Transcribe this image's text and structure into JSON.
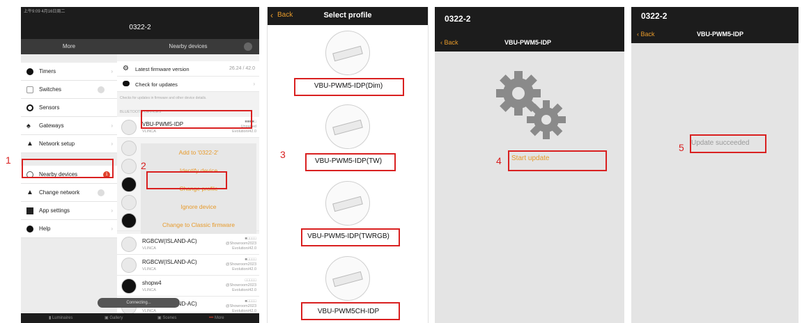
{
  "steps": [
    "1",
    "2",
    "3",
    "4",
    "5"
  ],
  "panel1": {
    "status_left": "上午9:09  4月16日周二",
    "title": "0322-2",
    "left_header": "More",
    "right_header": "Nearby devices",
    "menu": [
      {
        "label": "Timers",
        "icon": "clock-icon"
      },
      {
        "label": "Switches",
        "icon": "switch-icon"
      },
      {
        "label": "Sensors",
        "icon": "sensor-icon"
      },
      {
        "label": "Gateways",
        "icon": "gateway-icon"
      },
      {
        "label": "Network setup",
        "icon": "network-icon"
      },
      {
        "label": "Nearby devices",
        "icon": "nearby-icon",
        "badge": "1"
      },
      {
        "label": "Change network",
        "icon": "change-network-icon"
      },
      {
        "label": "App settings",
        "icon": "settings-icon"
      },
      {
        "label": "Help",
        "icon": "help-icon"
      }
    ],
    "firmware_label": "Latest firmware version",
    "firmware_value": "26.24 / 42.0",
    "check_updates": "Check for updates",
    "check_updates_hint": "Checks for updates in firmware and other device details.",
    "bluetooth_header": "BLUETOOTH DEVICES",
    "selected_device": {
      "name": "VBU-PWM5-IDP",
      "vendor": "VLINCA",
      "status": "Unpaired",
      "meta": "Evolution/42.0"
    },
    "context_menu": [
      "Add to '0322-2'",
      "Identify device",
      "Change profile",
      "Ignore device",
      "Change to Classic firmware"
    ],
    "devices": [
      {
        "name": "RGBCW(ISLAND-AC)",
        "vendor": "VLINCA",
        "meta1": "@Showroom2023",
        "meta2": "Evolution/42.0"
      },
      {
        "name": "RGBCW(ISLAND-AC)",
        "vendor": "VLINCA",
        "meta1": "@Showroom2023",
        "meta2": "Evolution/42.0"
      },
      {
        "name": "shopw4",
        "vendor": "VLINCA",
        "meta1": "@Showroom2023",
        "meta2": "Evolution/42.0"
      },
      {
        "name": "RGBCW(ISLAND-AC)",
        "vendor": "VLINCA",
        "meta1": "@Showroom2023",
        "meta2": "Evolution/42.0"
      }
    ],
    "toast": "Connecting...",
    "tabs": [
      "Luminaires",
      "Gallery",
      "Scenes",
      "More"
    ]
  },
  "panel2": {
    "back": "Back",
    "title": "Select profile",
    "profiles": [
      "VBU-PWM5-IDP(Dim)",
      "VBU-PWM5-IDP(TW)",
      "VBU-PWM5-IDP(TWRGB)",
      "VBU-PWM5CH-IDP"
    ]
  },
  "panel3": {
    "network": "0322-2",
    "back": "Back",
    "title": "VBU-PWM5-IDP",
    "action": "Start update"
  },
  "panel4": {
    "network": "0322-2",
    "back": "Back",
    "title": "VBU-PWM5-IDP",
    "message": "Update succeeded"
  },
  "colors": {
    "accent": "#e79a2a",
    "highlight": "#d92020",
    "nav": "#1c1c1c",
    "badge": "#e0402a"
  }
}
